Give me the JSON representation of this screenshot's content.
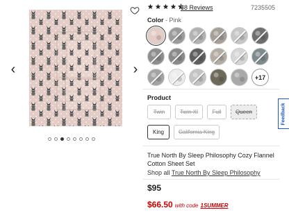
{
  "rating": {
    "stars": 4.5,
    "review_count": "68 Reviews"
  },
  "sku": "7235505",
  "color": {
    "label": "Color",
    "separator": " - ",
    "selected": "Pink"
  },
  "swatches": [
    {
      "name": "pink-bulldog",
      "color": "#e3cdc6",
      "available": true,
      "selected": true
    },
    {
      "name": "grey-geo",
      "color": "#9b9b9b",
      "available": false
    },
    {
      "name": "grey-print",
      "color": "#b2b2b2",
      "available": false
    },
    {
      "name": "taupe-geo",
      "color": "#a59f98",
      "available": false
    },
    {
      "name": "silver-stripe",
      "color": "#c6c6c6",
      "available": false
    },
    {
      "name": "charcoal",
      "color": "#6e6e6e",
      "available": false
    },
    {
      "name": "grey-pattern",
      "color": "#8e8e8e",
      "available": false
    },
    {
      "name": "slate-print",
      "color": "#8a8a8a",
      "available": false
    },
    {
      "name": "dark-print",
      "color": "#5f5f5f",
      "available": false
    },
    {
      "name": "beige-animal",
      "color": "#b4aca3",
      "available": false
    },
    {
      "name": "ivory-star",
      "color": "#d6d6d6",
      "available": false
    },
    {
      "name": "teal-grey",
      "color": "#7d8b8e",
      "available": false
    },
    {
      "name": "grey-buffalo",
      "color": "#a3a3a3",
      "available": false
    },
    {
      "name": "white-snow",
      "color": "#ececec",
      "available": false
    },
    {
      "name": "light-grey",
      "color": "#c3c3c3",
      "available": false
    },
    {
      "name": "olive-moose",
      "color": "#6e6a5a",
      "available": true
    },
    {
      "name": "grey-plaid",
      "color": "#a9a9a9",
      "available": true
    }
  ],
  "more_colors": "+17",
  "product": {
    "label": "Product",
    "sizes": [
      {
        "label": "Twin",
        "state": "unavailable"
      },
      {
        "label": "Twin Xl",
        "state": "unavailable"
      },
      {
        "label": "Full",
        "state": "unavailable"
      },
      {
        "label": "Queen",
        "state": "unavailable-focused"
      },
      {
        "label": "King",
        "state": "selected"
      },
      {
        "label": "California King",
        "state": "unavailable"
      }
    ]
  },
  "title": "True North By Sleep Philosophy Cozy Flannel Cotton Sheet Set",
  "shop_all": {
    "prefix": "Shop all ",
    "brand": "True North By Sleep Philosophy"
  },
  "price": "$95",
  "sale": {
    "price": "$66.50",
    "with_code": "with code",
    "code": "1SUMMER"
  },
  "feedback": "Feedback",
  "gallery": {
    "image_count": 8,
    "active_index": 2
  },
  "colors": {
    "sale_red": "#cc0000",
    "feedback_blue": "#1a56c4",
    "star": "#222222",
    "fabric_pink": "#e3cdc6"
  },
  "icons": {
    "prev": "chevron-left-icon",
    "next": "chevron-right-icon",
    "favorite": "heart-icon"
  }
}
